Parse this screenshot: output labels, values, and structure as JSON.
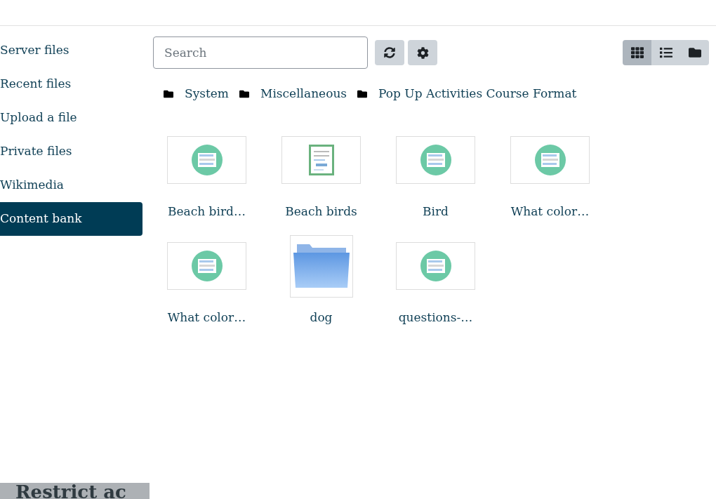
{
  "sidebar": {
    "items": [
      {
        "label": "Server files",
        "selected": false
      },
      {
        "label": "Recent files",
        "selected": false
      },
      {
        "label": "Upload a file",
        "selected": false
      },
      {
        "label": "Private files",
        "selected": false
      },
      {
        "label": "Wikimedia",
        "selected": false
      },
      {
        "label": "Content bank",
        "selected": true
      }
    ]
  },
  "search": {
    "placeholder": "Search"
  },
  "view_modes": [
    {
      "kind": "grid",
      "selected": true
    },
    {
      "kind": "list",
      "selected": false
    },
    {
      "kind": "tree",
      "selected": false
    }
  ],
  "breadcrumb": [
    "System",
    "Miscellaneous",
    "Pop Up Activities Course Format"
  ],
  "files": [
    {
      "kind": "activity",
      "name": "Beach bird…"
    },
    {
      "kind": "document",
      "name": "Beach birds"
    },
    {
      "kind": "activity",
      "name": "Bird"
    },
    {
      "kind": "activity",
      "name": "What color…"
    },
    {
      "kind": "activity",
      "name": "What color…"
    },
    {
      "kind": "folder",
      "name": "dog"
    },
    {
      "kind": "activity",
      "name": "questions-…"
    }
  ],
  "section_heading": "Restrict ac"
}
